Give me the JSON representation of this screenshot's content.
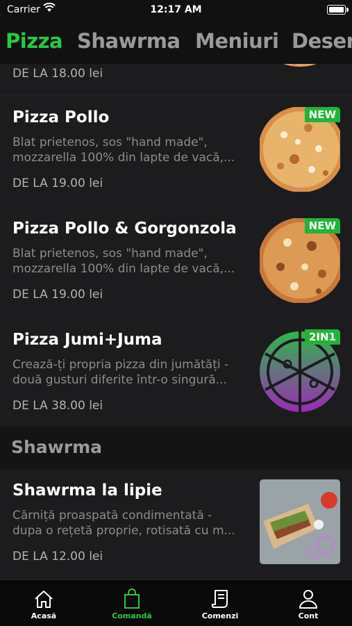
{
  "status": {
    "carrier": "Carrier",
    "time": "12:17 AM"
  },
  "tabs": [
    {
      "label": "Pizza",
      "active": true
    },
    {
      "label": "Shawrma",
      "active": false
    },
    {
      "label": "Meniuri",
      "active": false
    },
    {
      "label": "Deser",
      "active": false
    }
  ],
  "items": [
    {
      "price": "DE LA 18.00 lei"
    },
    {
      "name": "Pizza Pollo",
      "desc1": "Blat prietenos, sos \"hand made\",",
      "desc2": "mozzarella 100% din lapte de vacă,...",
      "price": "DE LA 19.00 lei",
      "badge": "NEW"
    },
    {
      "name": "Pizza Pollo & Gorgonzola",
      "desc1": "Blat prietenos, sos \"hand made\",",
      "desc2": "mozzarella 100% din lapte de vacă,...",
      "price": "DE LA 19.00 lei",
      "badge": "NEW"
    },
    {
      "name": "Pizza Jumi+Juma",
      "desc1": "Crează-ți propria pizza din jumătăți -",
      "desc2": "două gusturi diferite într-o singură...",
      "price": "DE LA 38.00 lei",
      "badge": "2IN1"
    }
  ],
  "section": {
    "title": "Shawrma"
  },
  "shawrma": {
    "name": "Shawrma la lipie",
    "desc1": "Cărniță proaspată condimentată -",
    "desc2": "dupa o rețetă proprie, rotisată cu m...",
    "price": "DE LA 12.00 lei"
  },
  "nav": [
    {
      "label": "Acasă",
      "icon": "home-icon",
      "active": false
    },
    {
      "label": "Comandă",
      "icon": "bag-icon",
      "active": true
    },
    {
      "label": "Comenzi",
      "icon": "receipt-icon",
      "active": false
    },
    {
      "label": "Cont",
      "icon": "user-icon",
      "active": false
    }
  ],
  "colors": {
    "accent": "#27c93f",
    "background": "#1c1c1e"
  }
}
